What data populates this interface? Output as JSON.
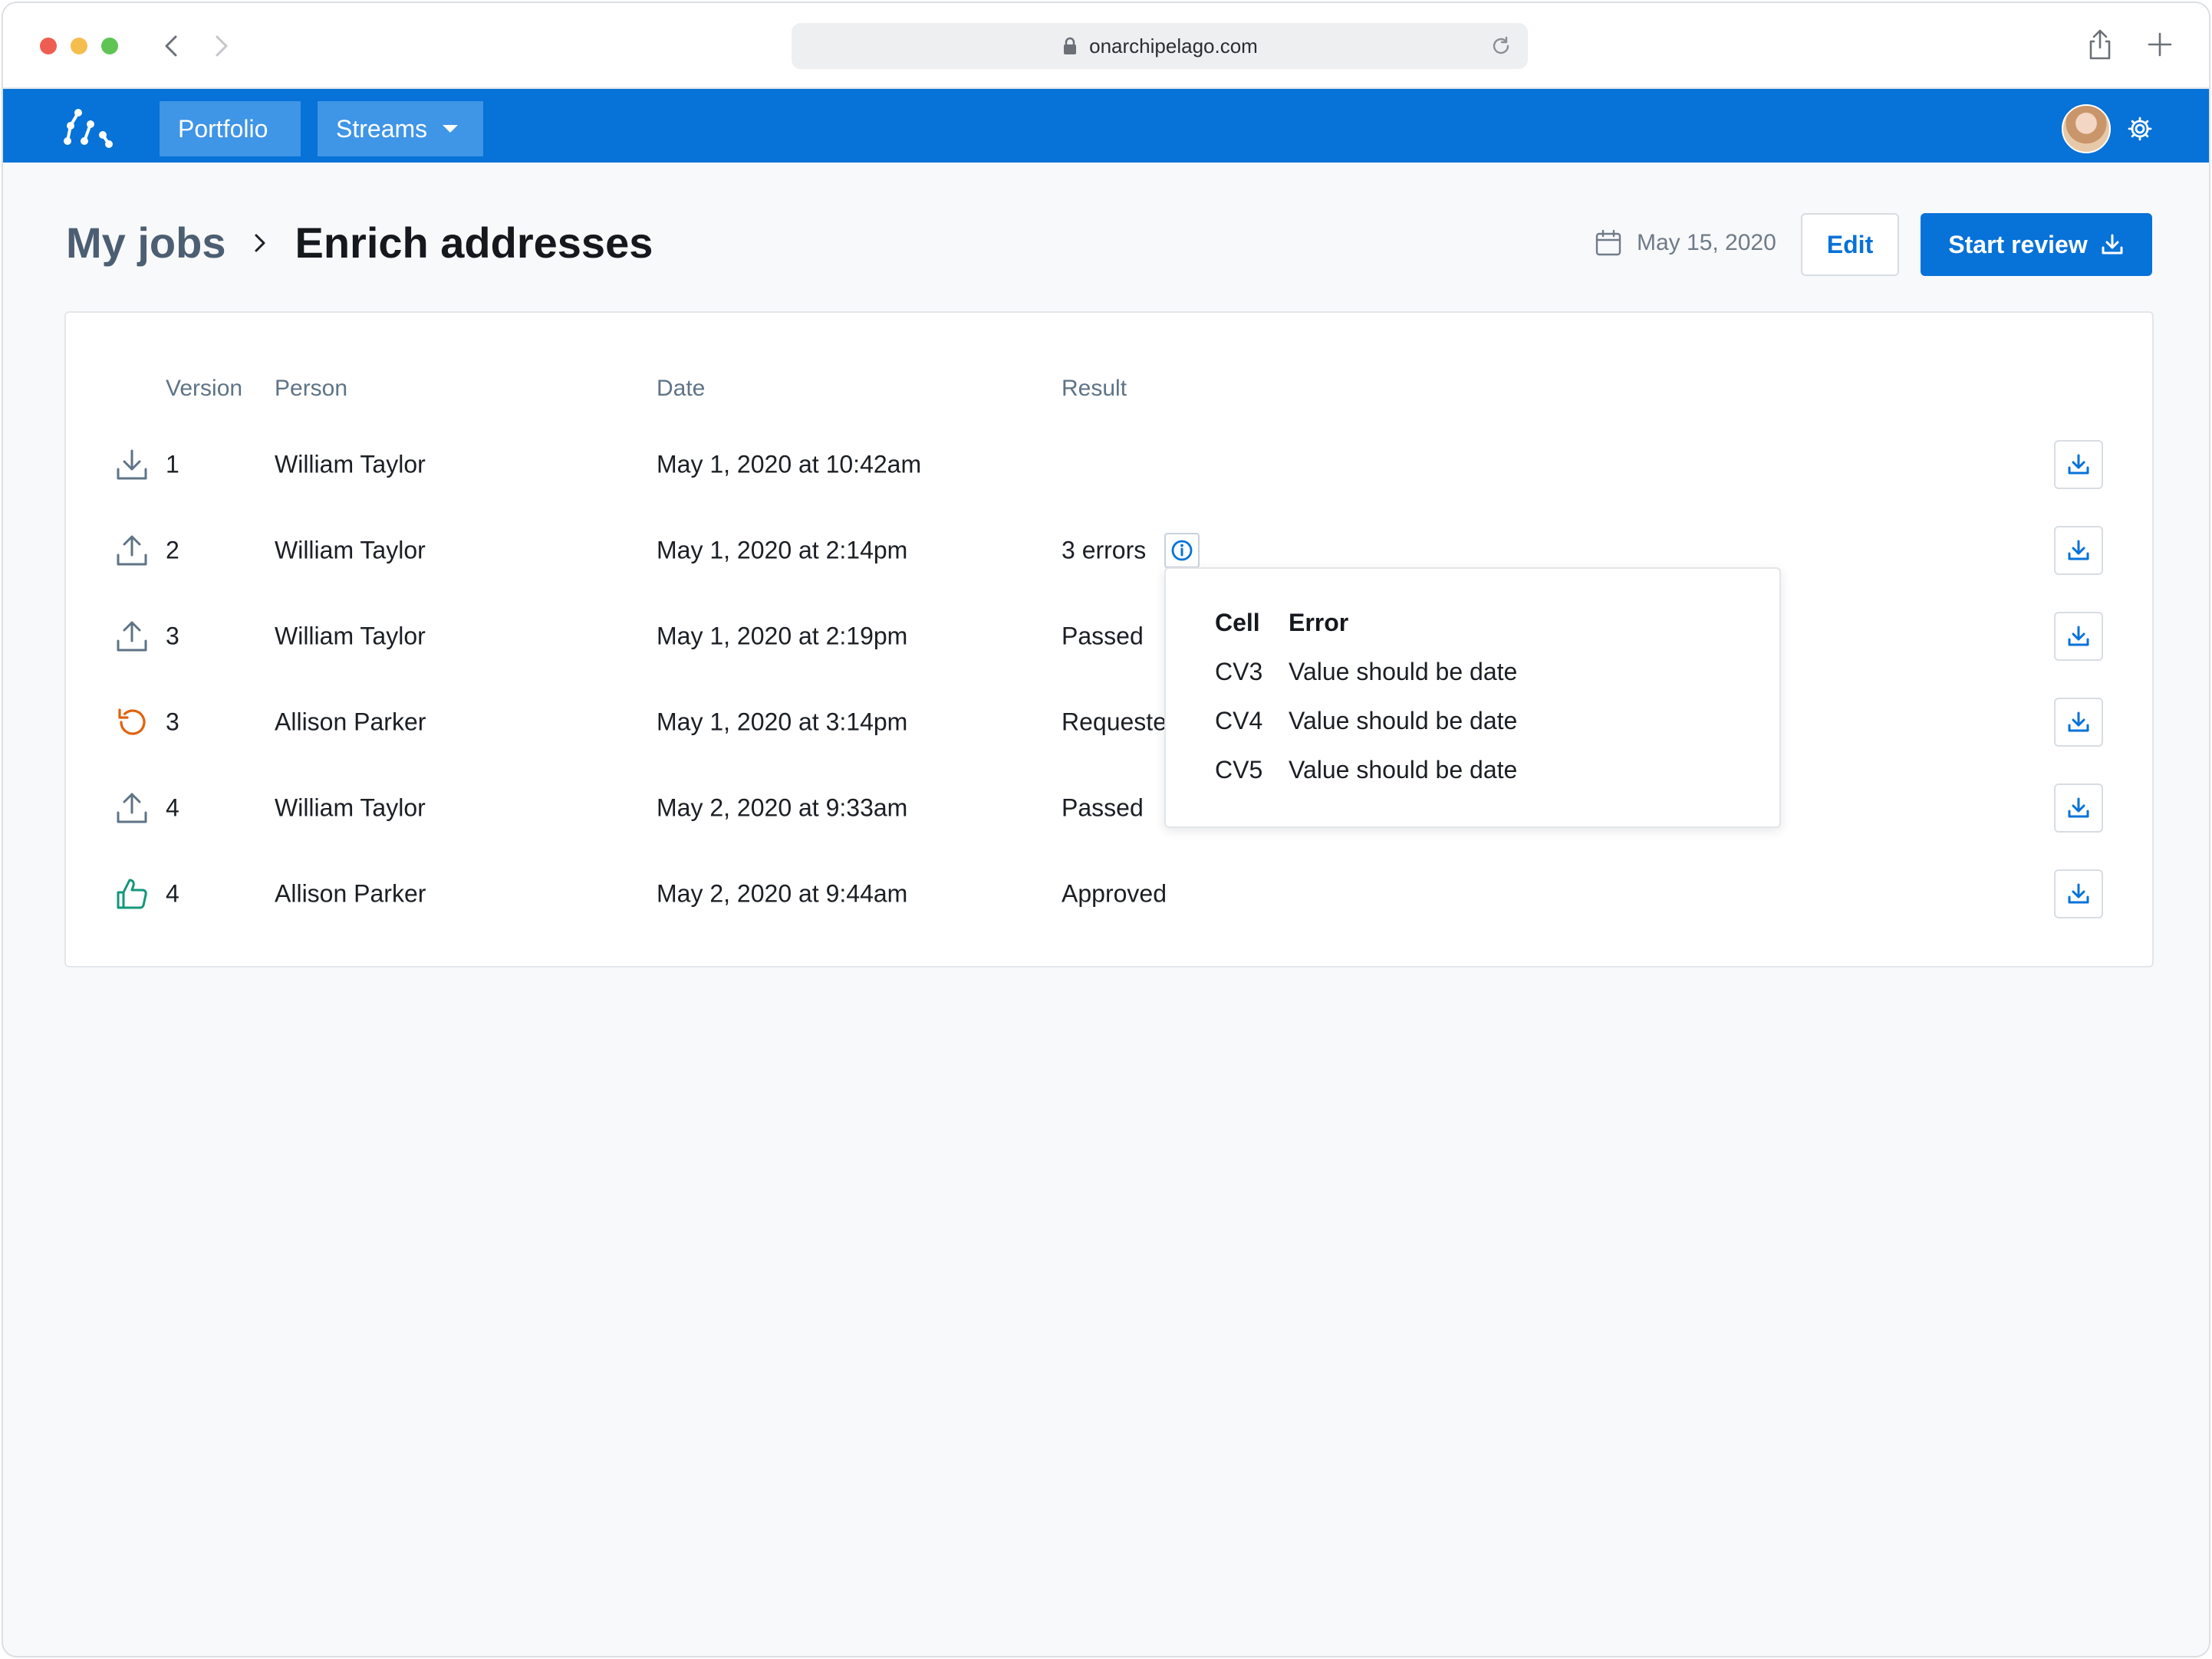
{
  "browser": {
    "url": "onarchipelago.com"
  },
  "nav": {
    "portfolio": "Portfolio",
    "streams": "Streams"
  },
  "header": {
    "parent": "My jobs",
    "title": "Enrich addresses",
    "date": "May 15, 2020",
    "edit": "Edit",
    "start_review": "Start review"
  },
  "table": {
    "columns": [
      "Version",
      "Person",
      "Date",
      "Result"
    ],
    "rows": [
      {
        "icon": "download-icon",
        "version": "1",
        "person": "William Taylor",
        "date": "May 1, 2020 at 10:42am",
        "result": ""
      },
      {
        "icon": "upload-icon",
        "version": "2",
        "person": "William Taylor",
        "date": "May 1, 2020 at 2:14pm",
        "result": "3 errors"
      },
      {
        "icon": "upload-icon",
        "version": "3",
        "person": "William Taylor",
        "date": "May 1, 2020 at 2:19pm",
        "result": "Passed"
      },
      {
        "icon": "undo-icon",
        "version": "3",
        "person": "Allison Parker",
        "date": "May 1, 2020 at 3:14pm",
        "result": "Requeste"
      },
      {
        "icon": "upload-icon",
        "version": "4",
        "person": "William Taylor",
        "date": "May 2, 2020 at 9:33am",
        "result": "Passed"
      },
      {
        "icon": "thumbs-up-icon",
        "version": "4",
        "person": "Allison Parker",
        "date": "May 2, 2020 at 9:44am",
        "result": "Approved"
      }
    ]
  },
  "popover": {
    "cell_header": "Cell",
    "error_header": "Error",
    "rows": [
      {
        "cell": "CV3",
        "error": "Value should be date"
      },
      {
        "cell": "CV4",
        "error": "Value should be date"
      },
      {
        "cell": "CV5",
        "error": "Value should be date"
      }
    ]
  },
  "colors": {
    "brand": "#0772d8",
    "nav_button": "#3f95e6",
    "undo": "#e0620d",
    "approve": "#13977b",
    "muted_icon": "#5f7386"
  }
}
